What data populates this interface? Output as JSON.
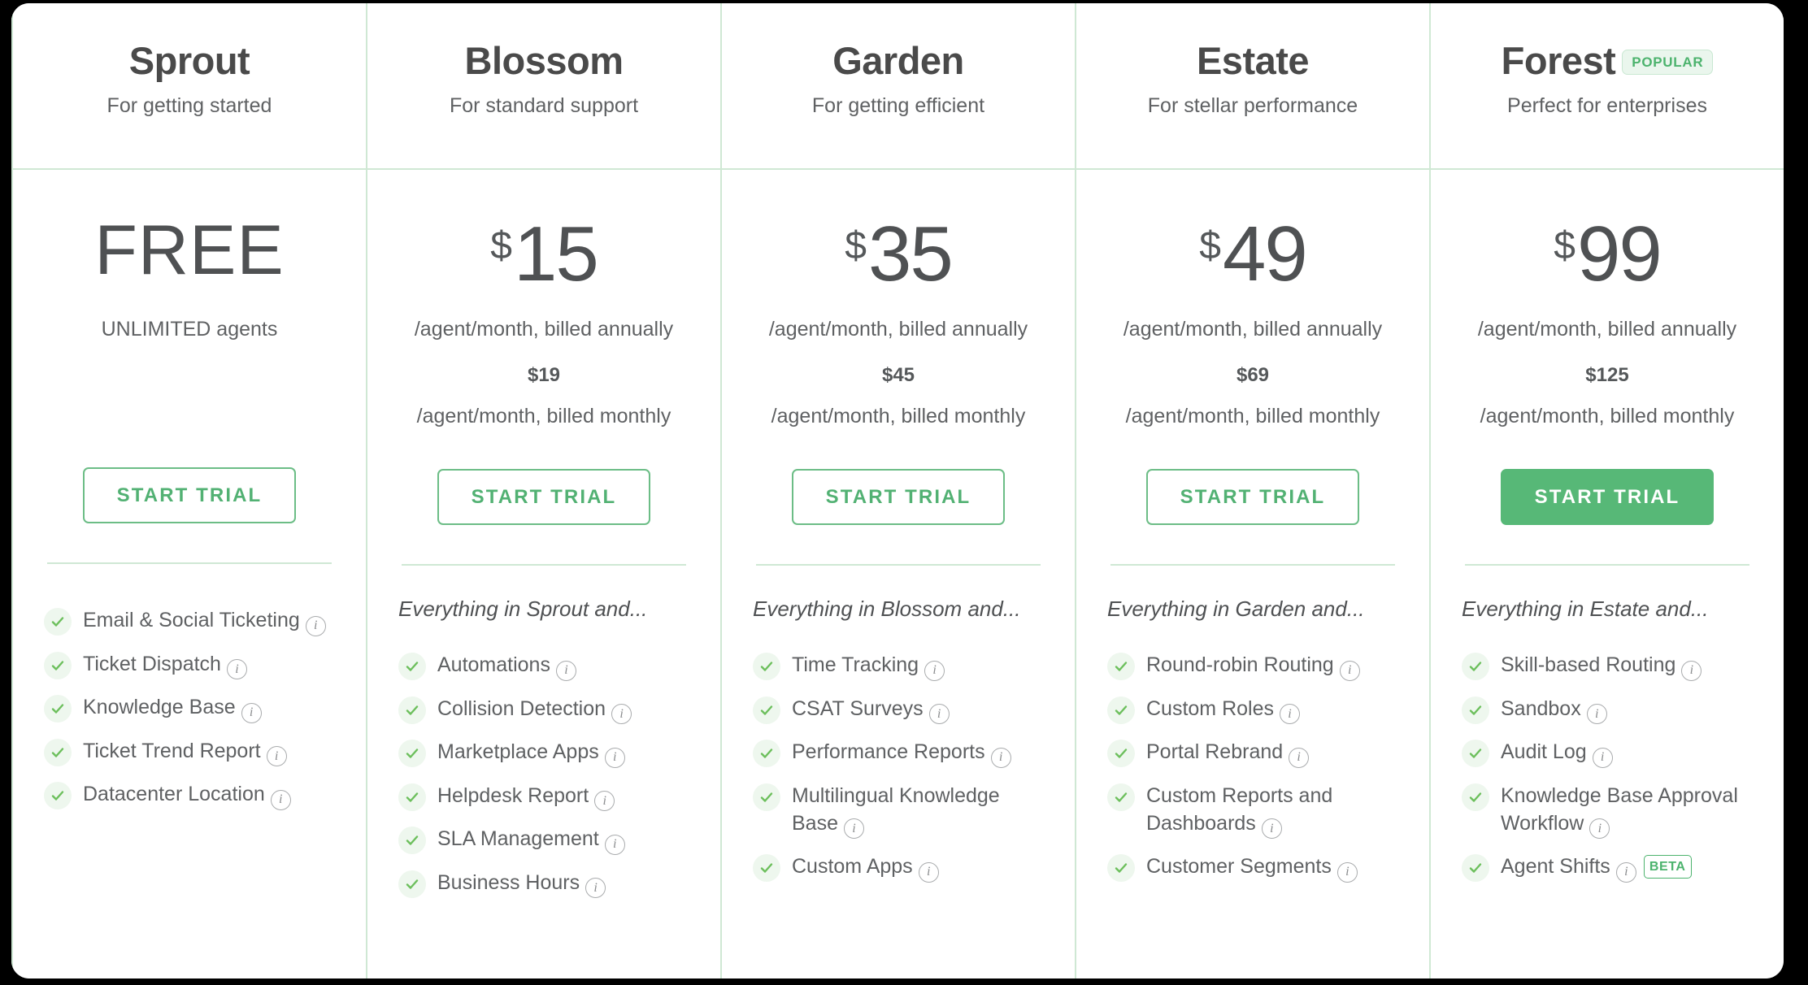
{
  "colors": {
    "brand_green": "#57b877",
    "border_green": "#cfe8d4",
    "check_green": "#6cbf5c",
    "badge_bg": "#eaf6ed",
    "text_dark": "#4a4a4a",
    "text_gray": "#5f6163",
    "page_bg": "#000000",
    "card_bg": "#ffffff"
  },
  "labels": {
    "start_trial": "START TRIAL",
    "popular_badge": "POPULAR",
    "beta_badge": "BETA",
    "info_glyph": "i",
    "currency_symbol": "$"
  },
  "plans": [
    {
      "name": "Sprout",
      "tagline": "For getting started",
      "popular": false,
      "price": "FREE",
      "is_free": true,
      "currency": "",
      "billing_note": "UNLIMITED agents",
      "alt_price": "",
      "alt_note": "",
      "cta": "START TRIAL",
      "cta_style": "outline",
      "inherits": "",
      "features": [
        {
          "label": "Email & Social Ticketing",
          "info": true,
          "beta": false
        },
        {
          "label": "Ticket Dispatch",
          "info": true,
          "beta": false
        },
        {
          "label": "Knowledge Base",
          "info": true,
          "beta": false
        },
        {
          "label": "Ticket Trend Report",
          "info": true,
          "beta": false
        },
        {
          "label": "Datacenter Location",
          "info": true,
          "beta": false
        }
      ]
    },
    {
      "name": "Blossom",
      "tagline": "For standard support",
      "popular": false,
      "price": "15",
      "is_free": false,
      "currency": "$",
      "billing_note": "/agent/month, billed annually",
      "alt_price": "$19",
      "alt_note": "/agent/month, billed monthly",
      "cta": "START TRIAL",
      "cta_style": "outline",
      "inherits": "Everything in Sprout and...",
      "features": [
        {
          "label": "Automations",
          "info": true,
          "beta": false
        },
        {
          "label": "Collision Detection",
          "info": true,
          "beta": false
        },
        {
          "label": "Marketplace Apps",
          "info": true,
          "beta": false
        },
        {
          "label": "Helpdesk Report",
          "info": true,
          "beta": false
        },
        {
          "label": "SLA Management",
          "info": true,
          "beta": false
        },
        {
          "label": "Business Hours",
          "info": true,
          "beta": false
        }
      ]
    },
    {
      "name": "Garden",
      "tagline": "For getting efficient",
      "popular": false,
      "price": "35",
      "is_free": false,
      "currency": "$",
      "billing_note": "/agent/month, billed annually",
      "alt_price": "$45",
      "alt_note": "/agent/month, billed monthly",
      "cta": "START TRIAL",
      "cta_style": "outline",
      "inherits": "Everything in Blossom and...",
      "features": [
        {
          "label": "Time Tracking",
          "info": true,
          "beta": false
        },
        {
          "label": "CSAT Surveys",
          "info": true,
          "beta": false
        },
        {
          "label": "Performance Reports",
          "info": true,
          "beta": false
        },
        {
          "label": "Multilingual Knowledge Base",
          "info": true,
          "beta": false
        },
        {
          "label": "Custom Apps",
          "info": true,
          "beta": false
        }
      ]
    },
    {
      "name": "Estate",
      "tagline": "For stellar performance",
      "popular": false,
      "price": "49",
      "is_free": false,
      "currency": "$",
      "billing_note": "/agent/month, billed annually",
      "alt_price": "$69",
      "alt_note": "/agent/month, billed monthly",
      "cta": "START TRIAL",
      "cta_style": "outline",
      "inherits": "Everything in Garden and...",
      "features": [
        {
          "label": "Round-robin Routing",
          "info": true,
          "beta": false
        },
        {
          "label": "Custom Roles",
          "info": true,
          "beta": false
        },
        {
          "label": "Portal Rebrand",
          "info": true,
          "beta": false
        },
        {
          "label": "Custom Reports and Dashboards",
          "info": true,
          "beta": false
        },
        {
          "label": "Customer Segments",
          "info": true,
          "beta": false
        }
      ]
    },
    {
      "name": "Forest",
      "tagline": "Perfect for enterprises",
      "popular": true,
      "price": "99",
      "is_free": false,
      "currency": "$",
      "billing_note": "/agent/month, billed annually",
      "alt_price": "$125",
      "alt_note": "/agent/month, billed monthly",
      "cta": "START TRIAL",
      "cta_style": "filled",
      "inherits": "Everything in Estate and...",
      "features": [
        {
          "label": "Skill-based Routing",
          "info": true,
          "beta": false
        },
        {
          "label": "Sandbox",
          "info": true,
          "beta": false
        },
        {
          "label": "Audit Log",
          "info": true,
          "beta": false
        },
        {
          "label": "Knowledge Base Approval Workflow",
          "info": true,
          "beta": false
        },
        {
          "label": "Agent Shifts",
          "info": true,
          "beta": true
        }
      ]
    }
  ]
}
